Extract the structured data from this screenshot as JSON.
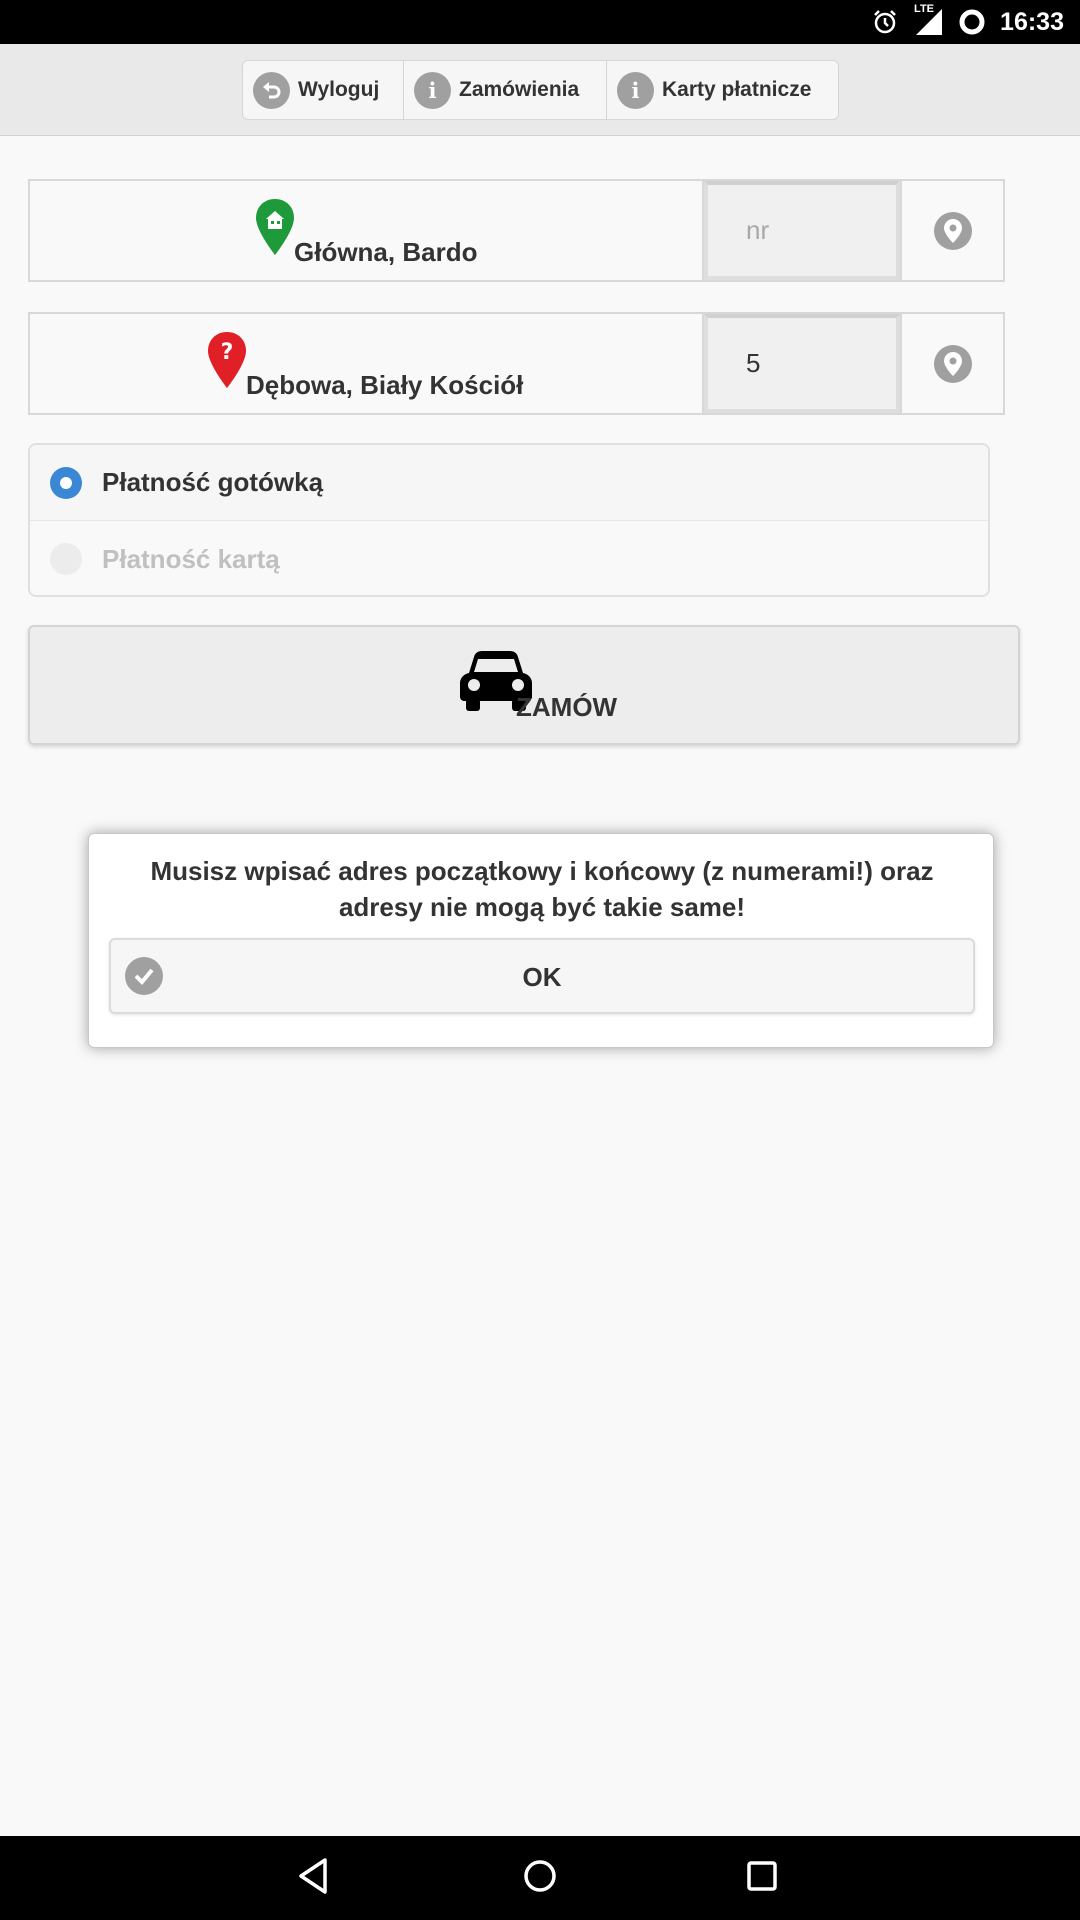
{
  "status_bar": {
    "time": "16:33",
    "network": "LTE",
    "icons": [
      "alarm-icon",
      "lte-signal-icon",
      "battery-icon"
    ]
  },
  "top_buttons": {
    "logout": {
      "label": "Wyloguj",
      "icon": "undo-icon"
    },
    "orders": {
      "label": "Zamówienia",
      "icon": "info-icon"
    },
    "cards": {
      "label": "Karty płatnicze",
      "icon": "info-icon"
    }
  },
  "start_address": {
    "label": "Główna, Bardo",
    "number_placeholder": "nr",
    "number_value": "",
    "pin_icon": "home-pin-icon",
    "pin_color": "#1e9a3a"
  },
  "end_address": {
    "label": "Dębowa, Biały Kościół",
    "number_value": "5",
    "pin_icon": "question-pin-icon",
    "pin_color": "#e01f26"
  },
  "payment": {
    "options": [
      {
        "label": "Płatność gotówką",
        "selected": true,
        "enabled": true
      },
      {
        "label": "Płatność kartą",
        "selected": false,
        "enabled": false
      }
    ]
  },
  "order_button": {
    "label": "ZAMÓW",
    "icon": "car-icon"
  },
  "dialog": {
    "message": "Musisz wpisać adres początkowy i końcowy (z numerami!) oraz adresy nie mogą być takie same!",
    "ok_label": "OK",
    "ok_icon": "check-icon"
  },
  "nav_bar": {
    "buttons": [
      "back-icon",
      "home-icon",
      "recents-icon"
    ]
  },
  "colors": {
    "accent": "#3a87d6",
    "icon_gray": "#a0a0a0"
  }
}
